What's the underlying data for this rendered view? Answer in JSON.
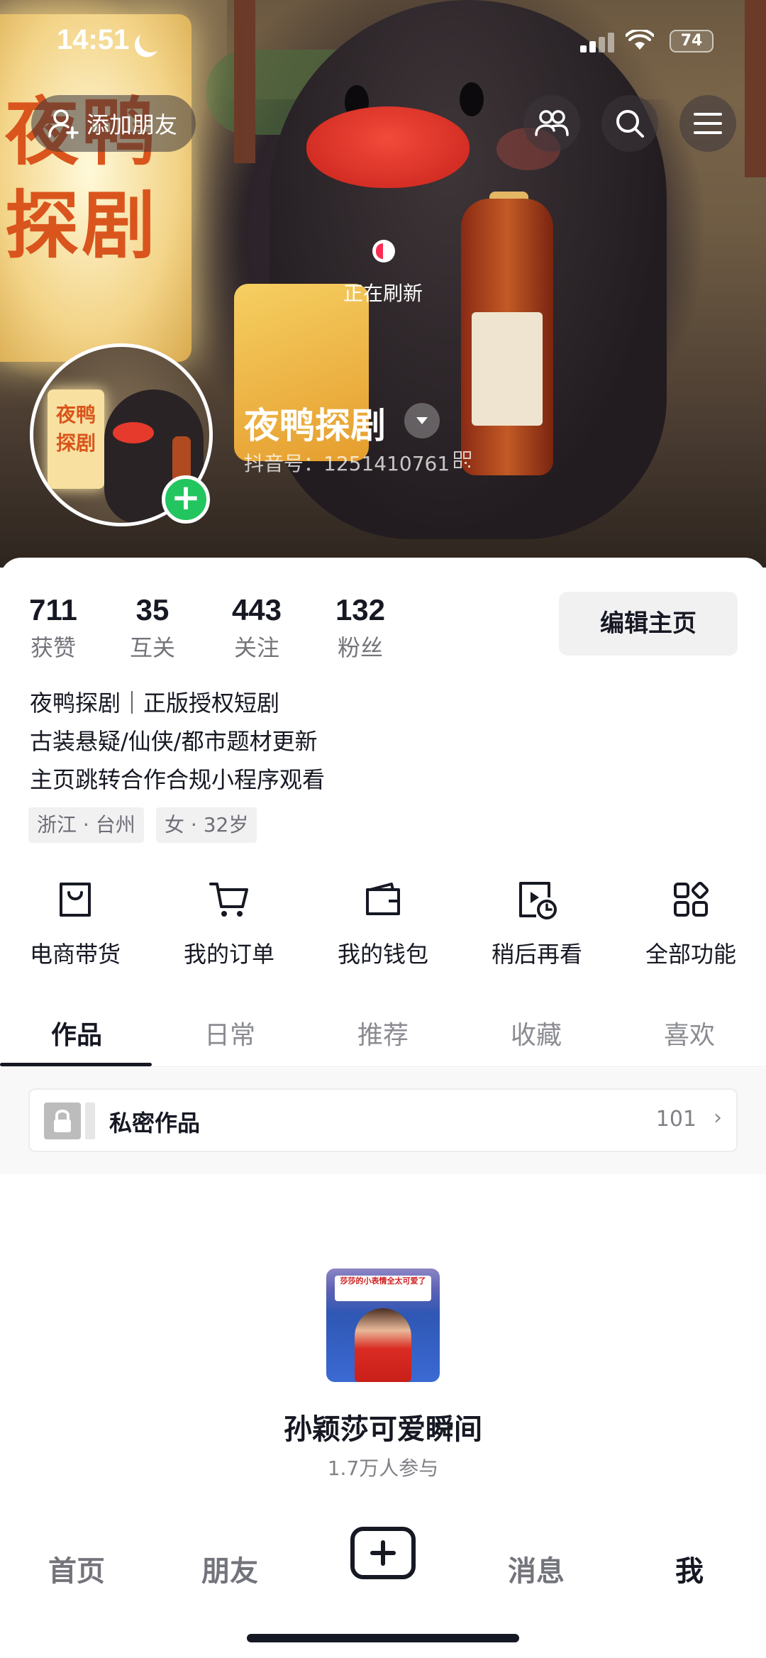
{
  "status_bar": {
    "time": "14:51",
    "battery": "74"
  },
  "header": {
    "add_friend_label": "添加朋友",
    "refresh_text": "正在刷新",
    "banner_sign": [
      "夜鸭",
      "探剧"
    ]
  },
  "avatar": {
    "sign": [
      "夜鸭",
      "探剧"
    ]
  },
  "profile": {
    "nickname": "夜鸭探剧",
    "douyin_id": "抖音号：1251410761"
  },
  "stats": [
    {
      "num": "711",
      "label": "获赞"
    },
    {
      "num": "35",
      "label": "互关"
    },
    {
      "num": "443",
      "label": "关注"
    },
    {
      "num": "132",
      "label": "粉丝"
    }
  ],
  "edit_button": "编辑主页",
  "bio": [
    "夜鸭探剧｜正版授权短剧",
    "古装悬疑/仙侠/都市题材更新",
    "主页跳转合作合规小程序观看"
  ],
  "tags": [
    "浙江 · 台州",
    "女 · 32岁"
  ],
  "features": [
    {
      "label": "电商带货",
      "icon": "shopping-bag-icon"
    },
    {
      "label": "我的订单",
      "icon": "cart-icon"
    },
    {
      "label": "我的钱包",
      "icon": "wallet-icon"
    },
    {
      "label": "稍后再看",
      "icon": "watch-later-icon"
    },
    {
      "label": "全部功能",
      "icon": "grid-icon"
    }
  ],
  "tabs": [
    "作品",
    "日常",
    "推荐",
    "收藏",
    "喜欢"
  ],
  "private_works": {
    "label": "私密作品",
    "count": "101"
  },
  "topic": {
    "thumb_text": "莎莎的小表情全太可爱了",
    "title": "孙颖莎可爱瞬间",
    "participants": "1.7万人参与"
  },
  "bottom_nav": [
    "首页",
    "朋友",
    "消息",
    "我"
  ],
  "colors": {
    "accent": "#fe2c55",
    "follow_green": "#22c55e",
    "text": "#161823"
  }
}
